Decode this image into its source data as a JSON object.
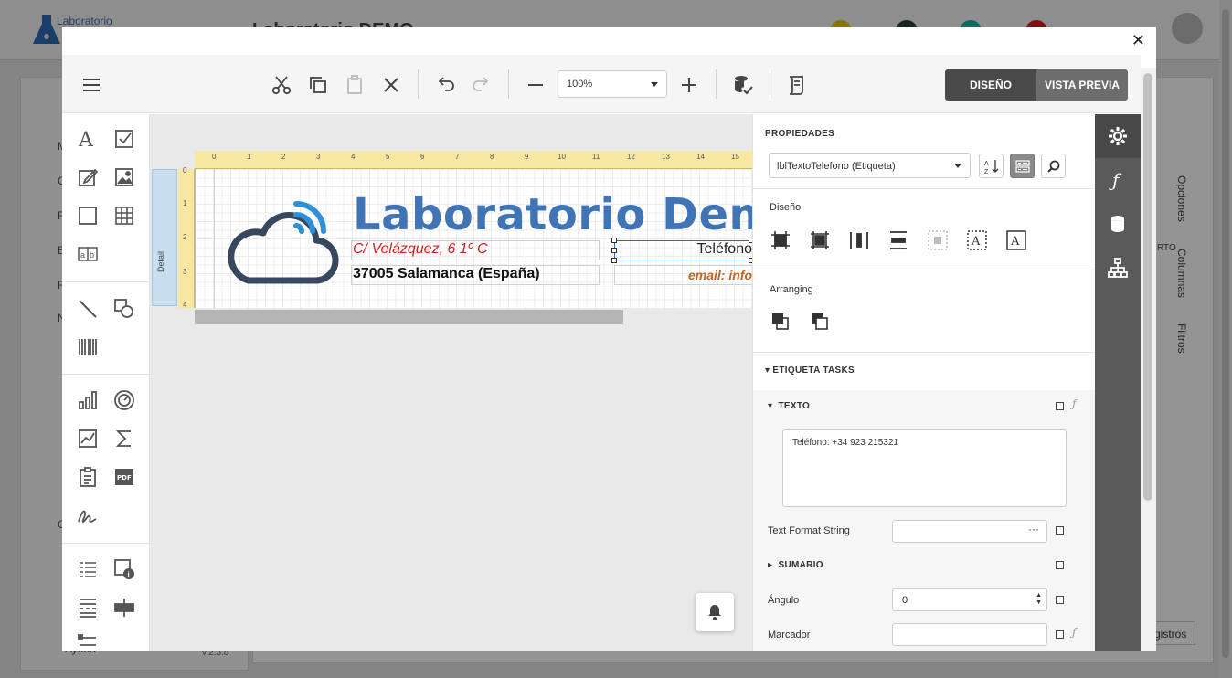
{
  "background": {
    "logo_text": "Laboratorio",
    "title": "Laboratorio DEMO",
    "side_letters": [
      "M",
      "C",
      "F",
      "E",
      "R",
      "N"
    ],
    "side_bottom_letter": "O",
    "right_tabs": [
      "Opciones",
      "Columnas",
      "Filtros"
    ],
    "right_fragment": "RTO",
    "registros_label": "gistros",
    "version": "v.2.3.8",
    "footer_fragment": "Ayuda"
  },
  "modal": {
    "close_label": "✕",
    "toolbar": {
      "zoom_value": "100%",
      "design_label": "DISEÑO",
      "preview_label": "VISTA PREVIA"
    }
  },
  "canvas": {
    "band_label": "Detail",
    "ruler_h": [
      "0",
      "1",
      "2",
      "3",
      "4",
      "5",
      "6",
      "7",
      "8",
      "9",
      "10",
      "11",
      "12",
      "13",
      "14",
      "15"
    ],
    "ruler_v": [
      "0",
      "1",
      "2",
      "3",
      "4"
    ],
    "company_title": "Laboratorio Demo",
    "address": "C/ Velázquez, 6 1º C",
    "city": "37005 Salamanca (España)",
    "phone_label": "Teléfono",
    "email_label": "email: info"
  },
  "properties": {
    "title": "PROPIEDADES",
    "selected_object": "lblTextoTelefono (Etiqueta)",
    "design_section": "Diseño",
    "arranging_section": "Arranging",
    "tasks_title": "ETIQUETA TASKS",
    "texto_title": "TEXTO",
    "texto_value": "Teléfono: +34 923 215321",
    "text_format_label": "Text Format String",
    "text_format_value": "",
    "sumario_title": "SUMARIO",
    "angulo_label": "Ángulo",
    "angulo_value": "0",
    "marcador_label": "Marcador",
    "marcador_value": ""
  },
  "colors": {
    "brand_blue": "#4074b4",
    "address_red": "#d21f1f",
    "email_orange": "#c7641e",
    "dark_tab": "#5a5a5a",
    "ruler_yellow": "#f7e7a2"
  }
}
